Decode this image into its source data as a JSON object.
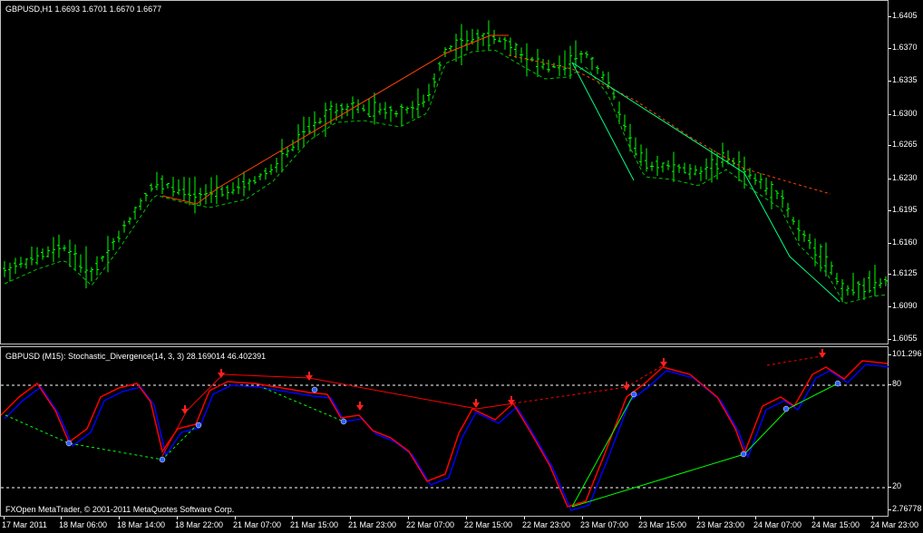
{
  "main_chart": {
    "header": "GBPUSD,H1  1.6693 1.6701 1.6670 1.6677",
    "price_labels": [
      "1.6405",
      "1.6370",
      "1.6335",
      "1.6300",
      "1.6265",
      "1.6230",
      "1.6195",
      "1.6160",
      "1.6125",
      "1.6090",
      "1.6055"
    ],
    "colors": {
      "bars": "#00ff00",
      "ma": "#ff4400",
      "trend": "#00ff7f"
    }
  },
  "indicator": {
    "header": "GBPUSD (M15):  Stochastic_Divergence(14, 3, 3) 28.169014 46.402391",
    "levels": [
      "101.296",
      "80",
      "20",
      "2.76778"
    ],
    "colors": {
      "main": "#0000ff",
      "signal": "#ff0000",
      "bear": "#ff0000",
      "bull": "#00ff00",
      "up_arrow": "#ff2020",
      "down_arrow": "#3060ff"
    }
  },
  "time_labels": [
    "17 Mar 2011",
    "18 Mar 06:00",
    "18 Mar 14:00",
    "18 Mar 22:00",
    "21 Mar 07:00",
    "21 Mar 15:00",
    "21 Mar 23:00",
    "22 Mar 07:00",
    "22 Mar 15:00",
    "22 Mar 23:00",
    "23 Mar 07:00",
    "23 Mar 15:00",
    "23 Mar 23:00",
    "24 Mar 07:00",
    "24 Mar 15:00",
    "24 Mar 23:00"
  ],
  "copyright": "FXOpen MetaTrader, © 2001-2011 MetaQuotes Software Corp."
}
